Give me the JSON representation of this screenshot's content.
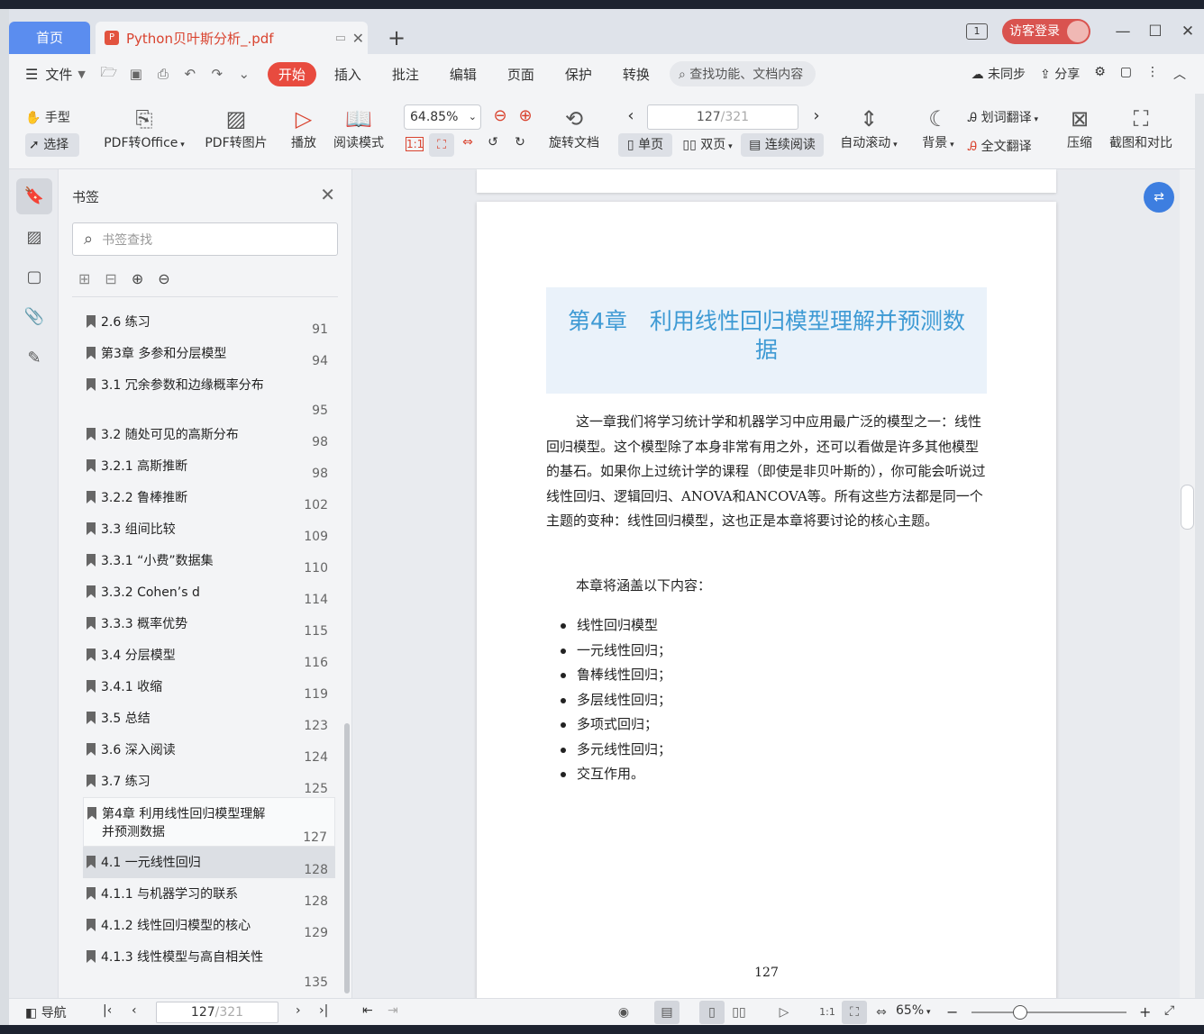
{
  "tabs": {
    "home": "首页",
    "doc_title": "Python贝叶斯分析_.pdf",
    "add": "+"
  },
  "titlebar": {
    "badge": "1",
    "login": "访客登录",
    "minimize": "—",
    "maximize": "☐",
    "close": "✕"
  },
  "menu": {
    "file": "文件",
    "items": [
      "开始",
      "插入",
      "批注",
      "编辑",
      "页面",
      "保护",
      "转换"
    ],
    "search": "查找功能、文档内容",
    "sync": "未同步",
    "share": "分享"
  },
  "ribbon": {
    "hand": "手型",
    "select": "选择",
    "pdf_office": "PDF转Office",
    "pdf_image": "PDF转图片",
    "play": "播放",
    "read_mode": "阅读模式",
    "zoom": "64.85%",
    "rotate_doc": "旋转文档",
    "page_current": "127",
    "page_total": "/321",
    "single": "单页",
    "double": "双页",
    "continuous": "连续阅读",
    "auto_scroll": "自动滚动",
    "background": "背景",
    "word_translate": "划词翻译",
    "full_translate": "全文翻译",
    "compress": "压缩",
    "screenshot_compare": "截图和对比"
  },
  "panel": {
    "title": "书签",
    "search_placeholder": "书签查找",
    "bookmarks": [
      {
        "title": "2.6 练习",
        "page": "91"
      },
      {
        "title": "第3章 多参和分层模型",
        "page": "94"
      },
      {
        "title": "3.1 冗余参数和边缘概率分布",
        "page": "95"
      },
      {
        "title": "3.2 随处可见的高斯分布",
        "page": "98"
      },
      {
        "title": "3.2.1 高斯推断",
        "page": "98"
      },
      {
        "title": "3.2.2 鲁棒推断",
        "page": "102"
      },
      {
        "title": "3.3 组间比较",
        "page": "109"
      },
      {
        "title": "3.3.1 “小费”数据集",
        "page": "110"
      },
      {
        "title": "3.3.2 Cohen’s d",
        "page": "114"
      },
      {
        "title": "3.3.3 概率优势",
        "page": "115"
      },
      {
        "title": "3.4 分层模型",
        "page": "116"
      },
      {
        "title": "3.4.1 收缩",
        "page": "119"
      },
      {
        "title": "3.5 总结",
        "page": "123"
      },
      {
        "title": "3.6 深入阅读",
        "page": "124"
      },
      {
        "title": "3.7 练习",
        "page": "125"
      },
      {
        "title": "第4章 利用线性回归模型理解并预测数据",
        "page": "127"
      },
      {
        "title": "4.1 一元线性回归",
        "page": "128"
      },
      {
        "title": "4.1.1 与机器学习的联系",
        "page": "128"
      },
      {
        "title": "4.1.2 线性回归模型的核心",
        "page": "129"
      },
      {
        "title": "4.1.3 线性模型与高自相关性",
        "page": "135"
      }
    ]
  },
  "doc": {
    "chapter_title": "第4章　利用线性回归模型理解并预测数据",
    "para1": "这一章我们将学习统计学和机器学习中应用最广泛的模型之一：线性回归模型。这个模型除了本身非常有用之外，还可以看做是许多其他模型的基石。如果你上过统计学的课程（即使是非贝叶斯的），你可能会听说过线性回归、逻辑回归、ANOVA和ANCOVA等。所有这些方法都是同一个主题的变种：线性回归模型，这也正是本章将要讨论的核心主题。",
    "para2": "本章将涵盖以下内容：",
    "bullets": [
      "线性回归模型",
      "一元线性回归；",
      "鲁棒线性回归；",
      "多层线性回归；",
      "多项式回归；",
      "多元线性回归；",
      "交互作用。"
    ],
    "page_number": "127"
  },
  "status": {
    "nav": "导航",
    "page_current": "127",
    "page_total": "/321",
    "zoom": "65%"
  }
}
